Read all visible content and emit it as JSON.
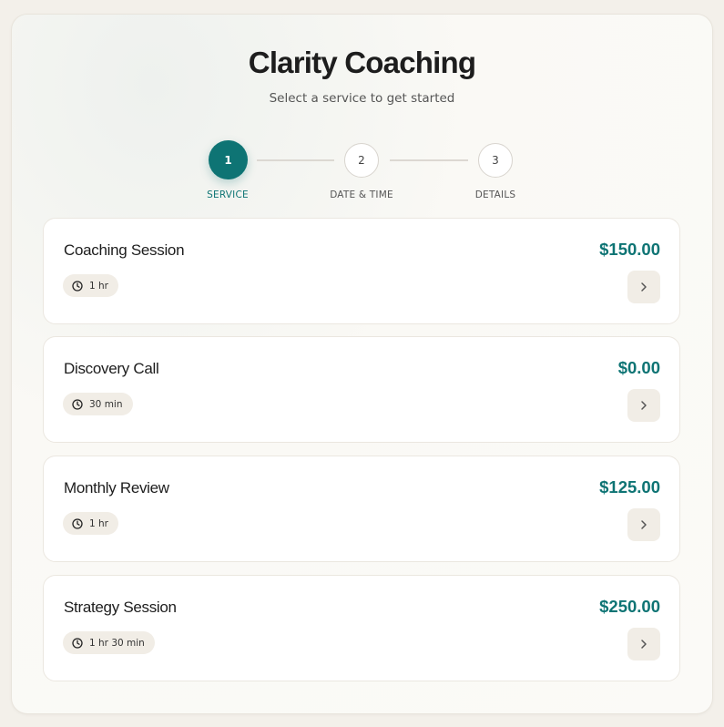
{
  "header": {
    "title": "Clarity Coaching",
    "subtitle": "Select a service to get started"
  },
  "stepper": {
    "steps": [
      {
        "number": "1",
        "label": "SERVICE",
        "active": true
      },
      {
        "number": "2",
        "label": "DATE & TIME",
        "active": false
      },
      {
        "number": "3",
        "label": "DETAILS",
        "active": false
      }
    ]
  },
  "services": [
    {
      "name": "Coaching Session",
      "price": "$150.00",
      "duration": "1 hr"
    },
    {
      "name": "Discovery Call",
      "price": "$0.00",
      "duration": "30 min"
    },
    {
      "name": "Monthly Review",
      "price": "$125.00",
      "duration": "1 hr"
    },
    {
      "name": "Strategy Session",
      "price": "$250.00",
      "duration": "1 hr 30 min"
    }
  ],
  "colors": {
    "accent": "#0e7474",
    "chip_background": "#f1ede6",
    "page_background": "#f3f0ea"
  },
  "icons": {
    "duration": "clock-icon",
    "select": "chevron-right-icon"
  }
}
